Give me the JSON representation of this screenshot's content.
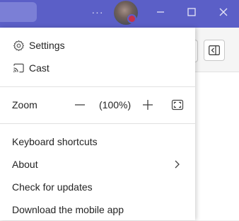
{
  "titlebar": {
    "more_label": "···"
  },
  "menu": {
    "settings": "Settings",
    "cast": "Cast",
    "zoom_label": "Zoom",
    "zoom_value": "(100%)",
    "keyboard_shortcuts": "Keyboard shortcuts",
    "about": "About",
    "check_updates": "Check for updates",
    "download_mobile": "Download the mobile app"
  },
  "icons": {
    "settings": "gear-icon",
    "cast": "cast-icon",
    "zoom_out": "minus-icon",
    "zoom_in": "plus-icon",
    "fullscreen": "fullscreen-icon",
    "about": "chevron-right-icon",
    "window": [
      "minimize-icon",
      "maximize-icon",
      "close-icon"
    ],
    "pane": "panel-toggle-icon"
  },
  "colors": {
    "titlebar": "#5b5fc7",
    "badge": "#c4314b",
    "text": "#242424"
  }
}
